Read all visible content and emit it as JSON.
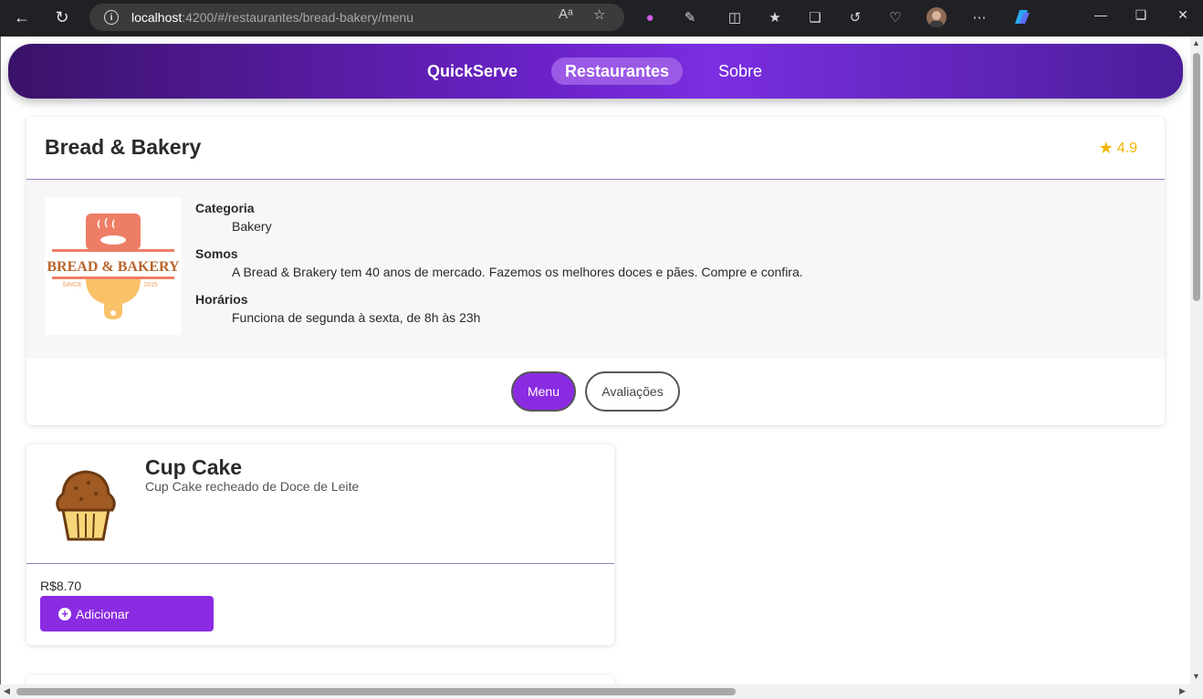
{
  "browser": {
    "url_host": "localhost",
    "url_path": ":4200/#/restaurantes/bread-bakery/menu",
    "read_aloud_icon": "Aᵃ"
  },
  "navbar": {
    "brand": "QuickServe",
    "links": [
      "Restaurantes",
      "Sobre"
    ],
    "active_color": "#9b59e6"
  },
  "restaurant": {
    "name": "Bread & Bakery",
    "rating": "4.9",
    "logo": {
      "top_text": "BREAD & BAKERY",
      "since": "SINCE",
      "year": "2015"
    },
    "info": [
      {
        "label": "Categoria",
        "value": "Bakery"
      },
      {
        "label": "Somos",
        "value": "A Bread & Brakery tem 40 anos de mercado. Fazemos os melhores doces e pães. Compre e confira."
      },
      {
        "label": "Horários",
        "value": "Funciona de segunda à sexta, de 8h às 23h"
      }
    ],
    "tabs": {
      "menu": "Menu",
      "reviews": "Avaliações"
    }
  },
  "menu_items": [
    {
      "name": "Cup Cake",
      "description": "Cup Cake recheado de Doce de Leite",
      "price": "R$8.70",
      "add_label": "Adicionar"
    }
  ],
  "colors": {
    "accent": "#8a2be2",
    "star": "#f3b400",
    "divider": "#9a7cc8"
  }
}
